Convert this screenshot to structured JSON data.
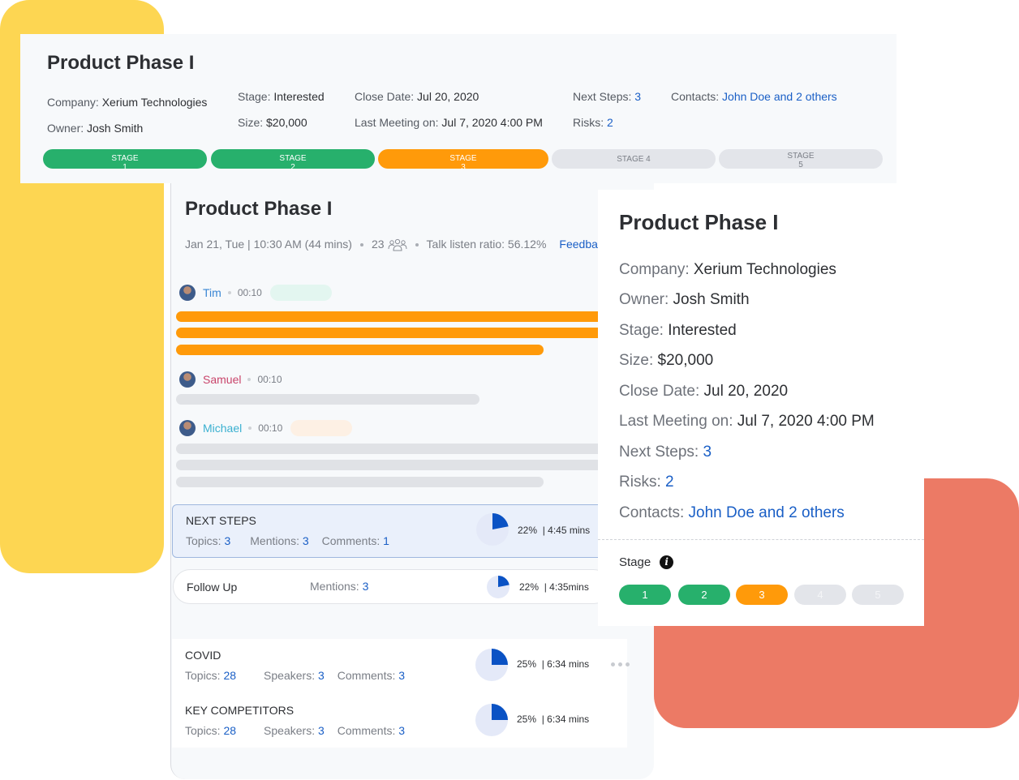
{
  "colors": {
    "yellow": "#fdd652",
    "coral": "#ec7a65",
    "green": "#27b06c",
    "orange": "#ff9a0a",
    "grey": "#e3e5ea",
    "link": "#1a5fc6"
  },
  "summary_card": {
    "title": "Product Phase I",
    "fields": {
      "company": {
        "label": "Company: ",
        "value": "Xerium Technologies"
      },
      "owner": {
        "label": "Owner: ",
        "value": "Josh Smith"
      },
      "stage": {
        "label": "Stage: ",
        "value": "Interested"
      },
      "size": {
        "label": "Size: ",
        "value": "$20,000"
      },
      "close_date": {
        "label": "Close Date: ",
        "value": "Jul 20, 2020"
      },
      "last_meeting": {
        "label": "Last Meeting on: ",
        "value": "Jul 7, 2020 4:00 PM"
      },
      "next_steps": {
        "label": "Next Steps: ",
        "value": "3"
      },
      "risks": {
        "label": "Risks: ",
        "value": "2"
      },
      "contacts": {
        "label": "Contacts: ",
        "value": "John Doe and 2 others"
      }
    },
    "stages": [
      {
        "label": "STAGE",
        "sub": "1",
        "status": "done"
      },
      {
        "label": "STAGE",
        "sub": "2",
        "status": "done"
      },
      {
        "label": "STAGE",
        "sub": "3",
        "status": "current"
      },
      {
        "label": "STAGE 4",
        "sub": "",
        "status": "pending"
      },
      {
        "label": "STAGE",
        "sub": "5",
        "status": "pending"
      }
    ]
  },
  "meeting_card": {
    "title": "Product Phase I",
    "meta": {
      "datetime": "Jan 21, Tue | 10:30 AM (44 mins)",
      "participants": "23",
      "participants_icon": "people-icon",
      "talk_ratio": "Talk listen ratio: 56.12%",
      "feedback_link": "Feedback"
    },
    "speakers": [
      {
        "name": "Tim",
        "time": "00:10",
        "name_color": "#3a86d4",
        "pill_color": "#e3f6f0"
      },
      {
        "name": "Samuel",
        "time": "00:10",
        "name_color": "#c9456b",
        "pill_color": ""
      },
      {
        "name": "Michael",
        "time": "00:10",
        "name_color": "#3ab0d0",
        "pill_color": "#fdf0e4"
      }
    ],
    "topics": [
      {
        "name": "NEXT STEPS",
        "stats": [
          {
            "label": "Topics: ",
            "value": "3"
          },
          {
            "label": "Mentions: ",
            "value": "3"
          },
          {
            "label": "Comments: ",
            "value": "1"
          }
        ],
        "percent": 22,
        "percent_label": "22%",
        "duration": "4:45 mins"
      },
      {
        "name": "Follow Up",
        "stats": [
          {
            "label": "Mentions: ",
            "value": "3"
          }
        ],
        "percent": 22,
        "percent_label": "22%",
        "duration": "4:35mins"
      },
      {
        "name": "COVID",
        "stats": [
          {
            "label": "Topics: ",
            "value": "28"
          },
          {
            "label": "Speakers: ",
            "value": "3"
          },
          {
            "label": "Comments: ",
            "value": "3"
          }
        ],
        "percent": 25,
        "percent_label": "25%",
        "duration": "6:34 mins"
      },
      {
        "name": "KEY COMPETITORS",
        "stats": [
          {
            "label": "Topics: ",
            "value": "28"
          },
          {
            "label": "Speakers: ",
            "value": "3"
          },
          {
            "label": "Comments: ",
            "value": "3"
          }
        ],
        "percent": 25,
        "percent_label": "25%",
        "duration": "6:34 mins"
      }
    ]
  },
  "detail_card": {
    "title": "Product Phase I",
    "fields": {
      "company": {
        "label": "Company: ",
        "value": "Xerium Technologies"
      },
      "owner": {
        "label": "Owner: ",
        "value": "Josh Smith"
      },
      "stage": {
        "label": "Stage: ",
        "value": "Interested"
      },
      "size": {
        "label": "Size: ",
        "value": "$20,000"
      },
      "close_date": {
        "label": "Close Date: ",
        "value": "Jul 20, 2020"
      },
      "last_meeting": {
        "label": "Last Meeting on: ",
        "value": "Jul 7, 2020 4:00 PM"
      },
      "next_steps": {
        "label": "Next Steps: ",
        "value": "3"
      },
      "risks": {
        "label": "Risks: ",
        "value": "2"
      },
      "contacts": {
        "label": "Contacts: ",
        "value": "John Doe and 2 others"
      }
    },
    "stage_label": "Stage",
    "stage_info_icon": "info-icon",
    "stage_pills": [
      {
        "label": "1",
        "status": "done"
      },
      {
        "label": "2",
        "status": "done"
      },
      {
        "label": "3",
        "status": "current"
      },
      {
        "label": "4",
        "status": "pending"
      },
      {
        "label": "5",
        "status": "pending"
      }
    ]
  }
}
